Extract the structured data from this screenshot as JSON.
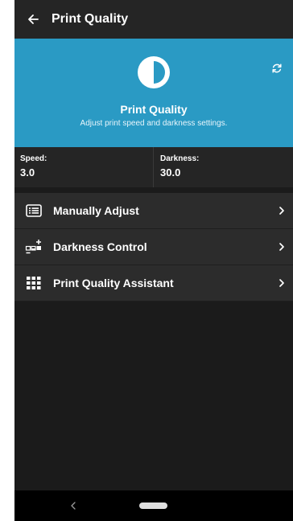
{
  "header": {
    "title": "Print Quality",
    "back_icon": "arrow-left-icon"
  },
  "hero": {
    "icon": "contrast-half-circle-icon",
    "refresh_icon": "refresh-icon",
    "title": "Print Quality",
    "subtitle": "Adjust print speed and darkness settings.",
    "background": "#2a9ac4"
  },
  "stats": {
    "speed": {
      "label": "Speed:",
      "value": "3.0"
    },
    "darkness": {
      "label": "Darkness:",
      "value": "30.0"
    }
  },
  "menu": {
    "items": [
      {
        "label": "Manually Adjust",
        "icon": "list-icon"
      },
      {
        "label": "Darkness Control",
        "icon": "darkness-adjust-icon"
      },
      {
        "label": "Print Quality Assistant",
        "icon": "grid-icon"
      }
    ]
  },
  "navbar": {
    "back_icon": "nav-back-icon",
    "home_icon": "nav-home-pill"
  }
}
